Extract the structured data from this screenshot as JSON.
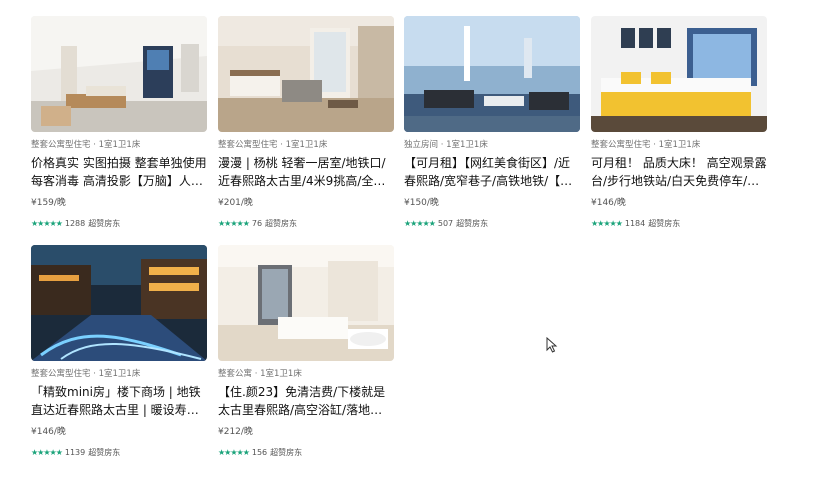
{
  "listings": [
    {
      "meta": "整套公寓型住宅 · 1室1卫1床",
      "title": "价格真实 实图拍摄 整套单独使用 每客消毒 高清投影【万脑】人民…",
      "price": "¥159/晚",
      "stars": "★★★★★",
      "reviews": "1288",
      "badge": "超赞房东"
    },
    {
      "meta": "整套公寓型住宅 · 1室1卫1床",
      "title": "漫漫 | 杨桃 轻奢一居室/地铁口/近春熙路太古里/4米9挑高/全景落…",
      "price": "¥201/晚",
      "stars": "★★★★★",
      "reviews": "76",
      "badge": "超赞房东"
    },
    {
      "meta": "独立房间 · 1室1卫1床",
      "title": "【可月租】【网红美食街区】/近春熙路/宽窄巷子/高铁地铁/【…",
      "price": "¥150/晚",
      "stars": "★★★★★",
      "reviews": "507",
      "badge": "超赞房东"
    },
    {
      "meta": "整套公寓型住宅 · 1室1卫1床",
      "title": "可月租！ 品质大床！ 高空观景露台/步行地铁站/白天免费停车/自…",
      "price": "¥146/晚",
      "stars": "★★★★★",
      "reviews": "1184",
      "badge": "超赞房东"
    },
    {
      "meta": "整套公寓型住宅 · 1室1卫1床",
      "title": "「精致mini房」楼下商场 | 地铁直达近春熙路太古里 | 暖设寿小吃…",
      "price": "¥146/晚",
      "stars": "★★★★★",
      "reviews": "1139",
      "badge": "超赞房东"
    },
    {
      "meta": "整套公寓 · 1室1卫1床",
      "title": "【住.颜23】免清洁费/下楼就是太古里春熙路/高空浴缸/落地窗带…",
      "price": "¥212/晚",
      "stars": "★★★★★",
      "reviews": "156",
      "badge": "超赞房东"
    }
  ],
  "colors": {
    "star": "#1aa37a",
    "title": "#111111",
    "meta": "#717171"
  },
  "icons": [
    "mouse-cursor-icon"
  ]
}
